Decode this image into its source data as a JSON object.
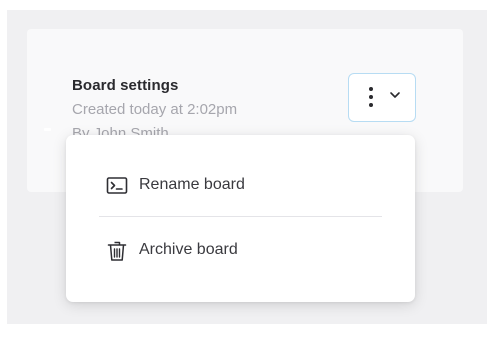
{
  "board_card": {
    "title": "Board settings",
    "created": "Created today at 2:02pm",
    "author": "By John Smith"
  },
  "menu_trigger": {
    "icon_more": "kebab-vertical",
    "icon_chevron": "chevron-down"
  },
  "menu": {
    "items": [
      {
        "label": "Rename board",
        "icon": "terminal-prompt"
      },
      {
        "label": "Archive board",
        "icon": "trash-can"
      }
    ]
  },
  "colors": {
    "trigger_border": "#b7dcf3",
    "text_primary": "#2a2a2e",
    "text_muted": "#a6a6ad"
  }
}
